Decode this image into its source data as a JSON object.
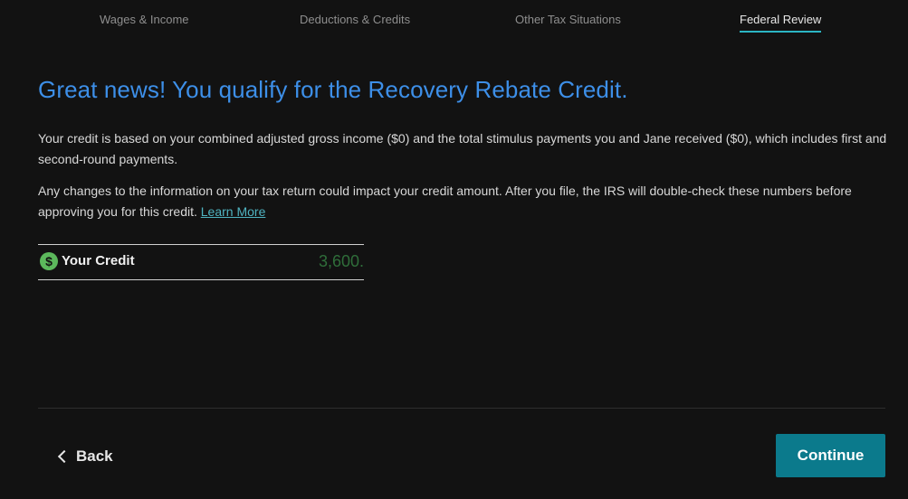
{
  "nav": {
    "tabs": [
      {
        "label": "Wages & Income",
        "active": false
      },
      {
        "label": "Deductions & Credits",
        "active": false
      },
      {
        "label": "Other Tax Situations",
        "active": false
      },
      {
        "label": "Federal Review",
        "active": true
      }
    ]
  },
  "main": {
    "headline": "Great news! You qualify for the Recovery Rebate Credit.",
    "paragraph1": "Your credit is based on your combined adjusted gross income ($0) and the total stimulus payments you and Jane received ($0), which includes first and second-round payments.",
    "paragraph2_text": "Any changes to the information on your tax return could impact your credit amount. After you file, the IRS will double-check these numbers before approving you for this credit.",
    "learn_more_label": "Learn More",
    "credit": {
      "icon": "dollar-icon",
      "icon_glyph": "$",
      "label": "Your Credit",
      "amount": "3,600."
    }
  },
  "footer": {
    "back_label": "Back",
    "continue_label": "Continue"
  },
  "colors": {
    "background": "#121212",
    "headline": "#3d8fe8",
    "accent_underline": "#2bb5c3",
    "link": "#4fb3c0",
    "continue_bg": "#0b7a8c",
    "credit_icon": "#5cb85c",
    "credit_amount": "#2f6e3a"
  }
}
